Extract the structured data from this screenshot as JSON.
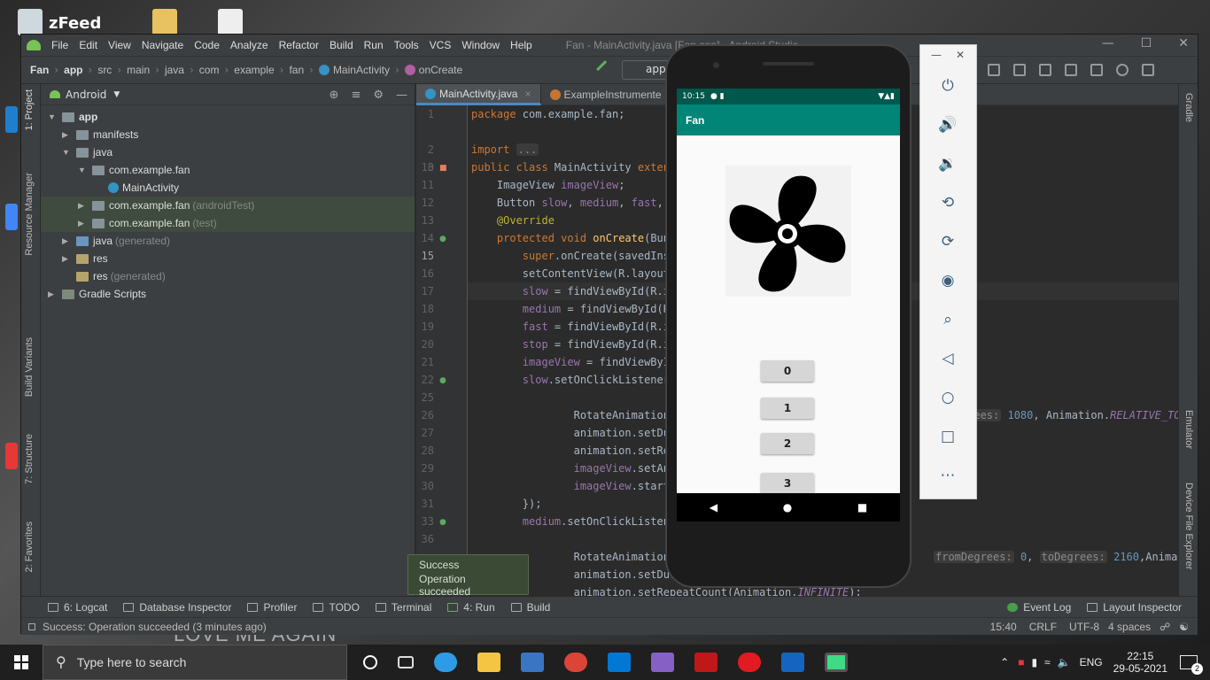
{
  "desktop": {
    "watermark": "LOVE ME AGAIN",
    "top_label": "zFeed"
  },
  "ide": {
    "menu": [
      "File",
      "Edit",
      "View",
      "Navigate",
      "Code",
      "Analyze",
      "Refactor",
      "Build",
      "Run",
      "Tools",
      "VCS",
      "Window",
      "Help"
    ],
    "window_title": "Fan - MainActivity.java [Fan.app] - Android Studio",
    "breadcrumbs": [
      "Fan",
      "app",
      "src",
      "main",
      "java",
      "com",
      "example",
      "fan",
      "MainActivity",
      "onCreate"
    ],
    "run_config": "app",
    "project_view": "Android",
    "tree": [
      {
        "label": "app",
        "note": ""
      },
      {
        "label": "manifests",
        "note": ""
      },
      {
        "label": "java",
        "note": ""
      },
      {
        "label": "com.example.fan",
        "note": ""
      },
      {
        "label": "MainActivity",
        "note": ""
      },
      {
        "label": "com.example.fan",
        "note": "(androidTest)"
      },
      {
        "label": "com.example.fan",
        "note": "(test)"
      },
      {
        "label": "java",
        "note": "(generated)"
      },
      {
        "label": "res",
        "note": ""
      },
      {
        "label": "res",
        "note": "(generated)"
      },
      {
        "label": "Gradle Scripts",
        "note": ""
      }
    ],
    "tabs": [
      "MainActivity.java",
      "ExampleInstrumente"
    ],
    "left_tool_tabs": [
      "1: Project",
      "Resource Manager",
      "Build Variants",
      "7: Structure",
      "2: Favorites"
    ],
    "right_tool_tabs": [
      "Gradle",
      "Emulator",
      "Device File Explorer"
    ],
    "code_lines": [
      "1",
      "2",
      "3",
      "10",
      "11",
      "12",
      "13",
      "14",
      "15",
      "16",
      "17",
      "18",
      "19",
      "20",
      "21",
      "22",
      "25",
      "26",
      "27",
      "28",
      "29",
      "30",
      "31",
      "33",
      "36"
    ],
    "toast": {
      "title": "Success",
      "message": "Operation succeeded"
    },
    "bottom_tools": [
      "6: Logcat",
      "Database Inspector",
      "Profiler",
      "TODO",
      "Terminal",
      "4: Run",
      "Build"
    ],
    "bottom_right_tools": [
      "Event Log",
      "Layout Inspector"
    ],
    "status_message": "Success: Operation succeeded (3 minutes ago)",
    "status_right": {
      "pos": "15:40",
      "eol": "CRLF",
      "enc": "UTF-8",
      "indent": "4 spaces"
    }
  },
  "emulator": {
    "time": "10:15",
    "app_title": "Fan",
    "buttons": [
      "0",
      "1",
      "2",
      "3"
    ]
  },
  "taskbar": {
    "search_placeholder": "Type here to search",
    "lang": "ENG",
    "time": "22:15",
    "date": "29-05-2021",
    "notifications": "2"
  },
  "colors": {
    "accent": "#008577",
    "status": "#00574b",
    "ide_bg": "#2b2b2b",
    "panel": "#3c3f41"
  }
}
